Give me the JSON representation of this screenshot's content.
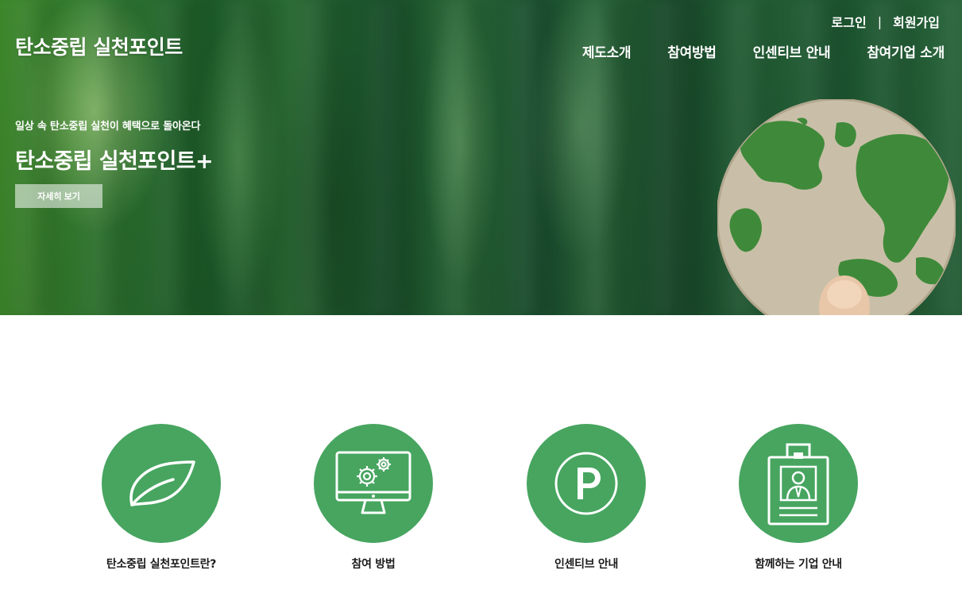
{
  "header": {
    "brand": "탄소중립 실천포인트",
    "auth": {
      "login": "로그인",
      "separator": "|",
      "signup": "회원가입"
    },
    "nav": [
      "제도소개",
      "참여방법",
      "인센티브 안내",
      "참여기업 소개"
    ]
  },
  "hero": {
    "subtitle": "일상 속 탄소중립 실천이 혜택으로 돌아온다",
    "title": "탄소중립 실천포인트+",
    "button": "자세히 보기"
  },
  "features": [
    {
      "label": "탄소중립 실천포인트란?",
      "icon": "leaf-icon"
    },
    {
      "label": "참여 방법",
      "icon": "monitor-gears-icon"
    },
    {
      "label": "인센티브 안내",
      "icon": "parking-p-icon"
    },
    {
      "label": "함께하는 기업 안내",
      "icon": "id-badge-icon"
    }
  ],
  "colors": {
    "accent_green": "#47a560",
    "text_white": "#ffffff"
  }
}
